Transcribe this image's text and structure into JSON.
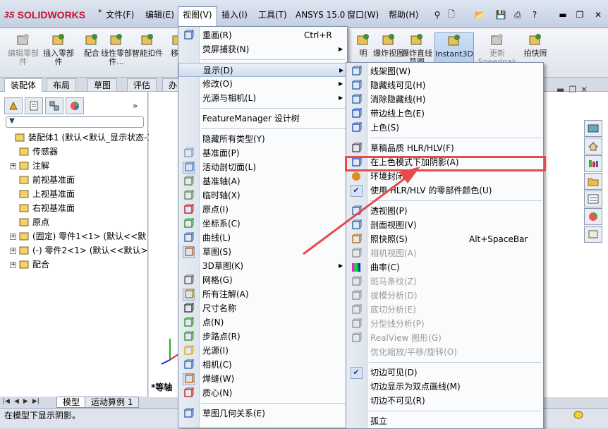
{
  "app": {
    "logo_text": "SOLIDWORKS",
    "logo_ds": "3S"
  },
  "menubar": [
    "文件(F)",
    "编辑(E)",
    "视图(V)",
    "插入(I)",
    "工具(T)",
    "ANSYS 15.0",
    "窗口(W)",
    "帮助(H)"
  ],
  "command_manager": [
    {
      "label": "编辑零部件",
      "icon": "edit-component-icon",
      "disabled": true
    },
    {
      "label": "插入零部件",
      "icon": "insert-component-icon"
    },
    {
      "label": "配合",
      "icon": "mate-icon"
    },
    {
      "label": "线性零部件...",
      "icon": "linear-pattern-icon"
    },
    {
      "label": "智能扣件",
      "icon": "smart-fastener-icon"
    },
    {
      "label": "移动",
      "icon": "move-component-icon"
    },
    {
      "label": "明",
      "icon": "show-hidden-icon"
    },
    {
      "label": "爆炸视图",
      "icon": "exploded-view-icon"
    },
    {
      "label": "爆炸直线草图",
      "icon": "explode-line-icon"
    },
    {
      "label": "Instant3D",
      "icon": "instant3d-icon",
      "active": true
    },
    {
      "label": "更新 Speedpak",
      "icon": "update-speedpak-icon",
      "disabled": true
    },
    {
      "label": "拍快照",
      "icon": "snapshot-icon"
    }
  ],
  "command_tabs": [
    "装配体",
    "布局",
    "草图",
    "评估",
    "办"
  ],
  "feature_tree": [
    {
      "label": "装配体1 (默认<默认_显示状态-1",
      "icon": "assembly-icon",
      "level": 0
    },
    {
      "label": "传感器",
      "icon": "sensor-icon",
      "level": 1
    },
    {
      "label": "注解",
      "icon": "annotation-icon",
      "level": 1,
      "expander": "+"
    },
    {
      "label": "前视基准面",
      "icon": "plane-icon",
      "level": 1
    },
    {
      "label": "上视基准面",
      "icon": "plane-icon",
      "level": 1
    },
    {
      "label": "右视基准面",
      "icon": "plane-icon",
      "level": 1
    },
    {
      "label": "原点",
      "icon": "origin-icon",
      "level": 1
    },
    {
      "label": "(固定) 零件1<1> (默认<<默",
      "icon": "part-icon",
      "level": 1,
      "expander": "+"
    },
    {
      "label": "(-) 零件2<1> (默认<<默认>",
      "icon": "part-icon",
      "level": 1,
      "expander": "+"
    },
    {
      "label": "配合",
      "icon": "mates-folder-icon",
      "level": 1,
      "expander": "+"
    }
  ],
  "bottom_tabs": [
    "模型",
    "运动算例 1"
  ],
  "status_text": "在模型下显示阴影。",
  "view_label": "*等轴",
  "view_menu": [
    {
      "label": "重画(R)",
      "shortcut": "Ctrl+R",
      "icon": "redraw-icon"
    },
    {
      "label": "荧屏捕获(N)",
      "submenu": true
    },
    {
      "sep": true
    },
    {
      "label": "显示(D)",
      "submenu": true,
      "hover": true
    },
    {
      "label": "修改(O)",
      "submenu": true
    },
    {
      "label": "光源与相机(L)",
      "submenu": true
    },
    {
      "sep": true
    },
    {
      "label": "FeatureManager 设计树"
    },
    {
      "sep": true
    },
    {
      "label": "隐藏所有类型(Y)"
    },
    {
      "label": "基准面(P)",
      "icon": "plane-icon"
    },
    {
      "label": "活动剖切面(L)",
      "icon": "section-plane-icon",
      "checked": true
    },
    {
      "label": "基准轴(A)",
      "icon": "axis-icon"
    },
    {
      "label": "临时轴(X)",
      "icon": "temp-axis-icon"
    },
    {
      "label": "原点(I)",
      "icon": "origin-icon"
    },
    {
      "label": "坐标系(C)",
      "icon": "coordinate-icon"
    },
    {
      "label": "曲线(L)",
      "icon": "curve-icon"
    },
    {
      "label": "草图(S)",
      "icon": "sketch-icon",
      "checked": true
    },
    {
      "label": "3D草图(K)",
      "submenu": true
    },
    {
      "label": "网格(G)",
      "icon": "grid-icon"
    },
    {
      "label": "所有注解(A)",
      "icon": "annotation-icon",
      "checked": true
    },
    {
      "label": "尺寸名称",
      "icon": "dimension-icon"
    },
    {
      "label": "点(N)",
      "icon": "point-icon"
    },
    {
      "label": "步路点(R)",
      "icon": "route-point-icon"
    },
    {
      "label": "光源(I)",
      "icon": "light-icon"
    },
    {
      "label": "相机(C)",
      "icon": "camera-icon"
    },
    {
      "label": "焊缝(W)",
      "icon": "weld-icon",
      "checked": true
    },
    {
      "label": "质心(N)",
      "icon": "mass-center-icon"
    },
    {
      "sep": true
    },
    {
      "label": "草图几何关系(E)",
      "icon": "sketch-relations-icon"
    }
  ],
  "display_menu": [
    {
      "label": "线架图(W)",
      "icon": "wireframe-icon"
    },
    {
      "label": "隐藏线可见(H)",
      "icon": "hidden-visible-icon"
    },
    {
      "label": "消除隐藏线(H)",
      "icon": "hidden-removed-icon"
    },
    {
      "label": "带边线上色(E)",
      "icon": "shaded-edges-icon"
    },
    {
      "label": "上色(S)",
      "icon": "shaded-icon"
    },
    {
      "sep": true
    },
    {
      "label": "草稿品质 HLR/HLV(F)",
      "icon": "draft-quality-icon"
    },
    {
      "label": "在上色模式下加阴影(A)",
      "icon": "shadows-icon",
      "highlight": true
    },
    {
      "label": "环境封闭",
      "icon": "ambient-occlusion-icon"
    },
    {
      "label": "使用 HLR/HLV 的零部件颜色(U)",
      "icon": "check-icon",
      "checked": true
    },
    {
      "sep": true
    },
    {
      "label": "透视图(P)",
      "icon": "perspective-icon"
    },
    {
      "label": "剖面视图(V)",
      "icon": "section-view-icon"
    },
    {
      "label": "照快照(S)",
      "shortcut": "Alt+SpaceBar",
      "icon": "snapshot-icon"
    },
    {
      "label": "相机视图(A)",
      "icon": "camera-view-icon",
      "disabled": true
    },
    {
      "label": "曲率(C)",
      "icon": "curvature-icon"
    },
    {
      "label": "斑马条纹(Z)",
      "icon": "zebra-icon",
      "disabled": true
    },
    {
      "label": "拔模分析(D)",
      "icon": "draft-analysis-icon",
      "disabled": true
    },
    {
      "label": "底切分析(E)",
      "icon": "undercut-icon",
      "disabled": true
    },
    {
      "label": "分型线分析(P)",
      "icon": "parting-line-icon",
      "disabled": true
    },
    {
      "label": "RealView 图形(G)",
      "icon": "realview-icon",
      "disabled": true
    },
    {
      "label": "优化缩放/平移/旋转(O)",
      "disabled": true
    },
    {
      "sep": true
    },
    {
      "label": "切边可见(D)",
      "icon": "check-icon",
      "checked": true
    },
    {
      "label": "切边显示为双点画线(M)"
    },
    {
      "label": "切边不可见(R)"
    },
    {
      "sep": true
    },
    {
      "label": "孤立"
    }
  ],
  "colors": {
    "highlight_box": "#e84a4a",
    "arrow": "#e84a4a",
    "menu_hover": "#cfdcee"
  }
}
